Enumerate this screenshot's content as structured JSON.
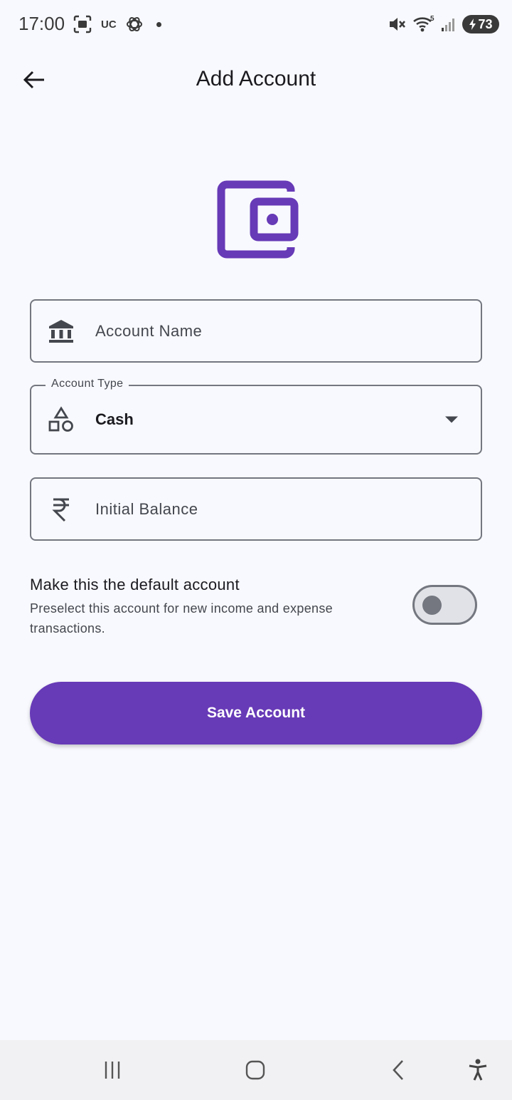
{
  "status_bar": {
    "time": "17:00",
    "uc_label": "UC",
    "battery_level": "73",
    "network_label": "5"
  },
  "app_bar": {
    "title": "Add Account"
  },
  "form": {
    "account_name": {
      "placeholder": "Account Name",
      "value": ""
    },
    "account_type": {
      "label": "Account Type",
      "value": "Cash"
    },
    "initial_balance": {
      "placeholder": "Initial Balance",
      "value": ""
    }
  },
  "default_account": {
    "title": "Make this the default account",
    "description": "Preselect this account for new income and expense transactions.",
    "enabled": false
  },
  "save_button": {
    "label": "Save Account"
  },
  "colors": {
    "accent": "#673ab7",
    "background": "#f8f9fe",
    "outline": "#74777f"
  },
  "icons": {
    "hero": "wallet-icon",
    "account_name": "bank-icon",
    "account_type": "category-shapes-icon",
    "initial_balance": "rupee-icon"
  }
}
